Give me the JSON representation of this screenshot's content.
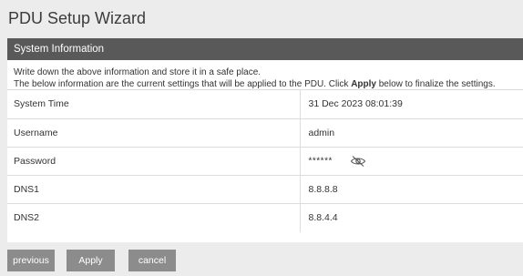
{
  "page": {
    "title": "PDU Setup Wizard"
  },
  "panel": {
    "header": "System Information",
    "notice_line1": "Write down the above information and store it in a safe place.",
    "notice_line2_before": "The below information are the current settings that will be applied to the PDU. Click ",
    "notice_line2_bold": "Apply",
    "notice_line2_after": " below to finalize the settings."
  },
  "rows": [
    {
      "label": "System Time",
      "value": "31 Dec 2023 08:01:39"
    },
    {
      "label": "Username",
      "value": "admin"
    },
    {
      "label": "Password",
      "value": "******",
      "icon": "eye-slash-icon"
    },
    {
      "label": "DNS1",
      "value": "8.8.8.8"
    },
    {
      "label": "DNS2",
      "value": "8.8.4.4"
    }
  ],
  "buttons": {
    "previous": "previous",
    "apply": "Apply",
    "cancel": "cancel"
  },
  "colors": {
    "header_bg": "#595959",
    "button_bg": "#8c8c8c",
    "page_bg": "#ececec"
  }
}
